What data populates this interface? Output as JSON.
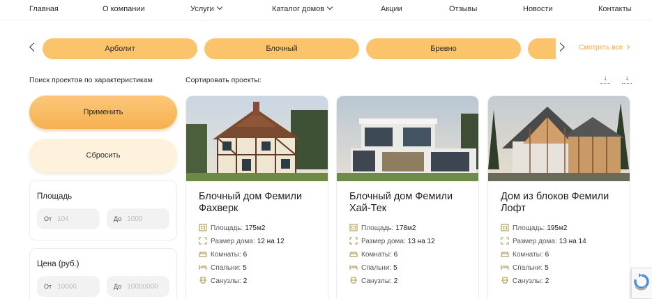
{
  "nav": {
    "items": [
      {
        "label": "Главная",
        "dropdown": false
      },
      {
        "label": "О компании",
        "dropdown": false
      },
      {
        "label": "Услуги",
        "dropdown": true
      },
      {
        "label": "Каталог домов",
        "dropdown": true
      },
      {
        "label": "Акции",
        "dropdown": false
      },
      {
        "label": "Отзывы",
        "dropdown": false
      },
      {
        "label": "Новости",
        "dropdown": false
      },
      {
        "label": "Контакты",
        "dropdown": false
      }
    ]
  },
  "categories": {
    "items": [
      "Арболит",
      "Блочный",
      "Бревно",
      ""
    ],
    "see_all": "Смотреть все",
    "accent_color": "#fbc46a"
  },
  "filters": {
    "title": "Поиск проектов по характеристикам",
    "apply_label": "Применить",
    "reset_label": "Сбросить",
    "area": {
      "label": "Площадь",
      "from_prefix": "От",
      "from_placeholder": "104",
      "to_prefix": "До",
      "to_placeholder": "1000"
    },
    "price": {
      "label": "Цена (руб.)",
      "from_prefix": "От",
      "from_placeholder": "10000",
      "to_prefix": "До",
      "to_placeholder": "10000000"
    }
  },
  "sort": {
    "label": "Сортировать проекты:",
    "icons": [
      "sort-down-icon",
      "sort-down-icon"
    ]
  },
  "spec_labels": {
    "area": "Площадь:",
    "size": "Размер дома:",
    "rooms": "Комнаты:",
    "bedrooms": "Спальни:",
    "bathrooms": "Санузлы:"
  },
  "projects": [
    {
      "title": "Блочный дом Фемили Фахверк",
      "area": "175м2",
      "size": "12 на 12",
      "rooms": "6",
      "bedrooms": "5",
      "bathrooms": "2",
      "image": "half-timbered-house"
    },
    {
      "title": "Блочный дом Фемили Хай-Тек",
      "area": "178м2",
      "size": "13 на 12",
      "rooms": "6",
      "bedrooms": "5",
      "bathrooms": "2",
      "image": "modern-house"
    },
    {
      "title": "Дом из блоков Фемили Лофт",
      "area": "195м2",
      "size": "13 на 14",
      "rooms": "6",
      "bedrooms": "5",
      "bathrooms": "2",
      "image": "loft-house"
    }
  ]
}
